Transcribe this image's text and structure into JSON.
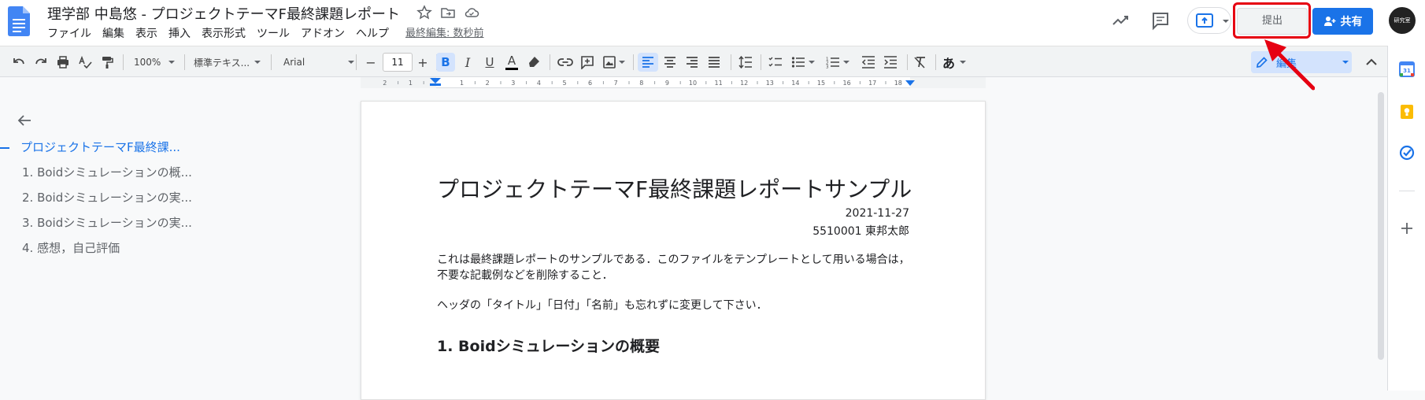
{
  "header": {
    "doc_title": "理学部 中島悠 - プロジェクトテーマF最終課題レポート",
    "menu": [
      "ファイル",
      "編集",
      "表示",
      "挿入",
      "表示形式",
      "ツール",
      "アドオン",
      "ヘルプ"
    ],
    "last_edit": "最終編集: 数秒前",
    "submit_label": "提出",
    "share_label": "共有",
    "avatar_text": "研究室"
  },
  "toolbar": {
    "zoom": "100%",
    "style": "標準テキス...",
    "font": "Arial",
    "font_size": "11",
    "minus": "−",
    "plus": "+",
    "bold": "B",
    "italic": "I",
    "underline": "U",
    "text_color": "A",
    "input_tool": "あ",
    "edit_mode": "編集"
  },
  "ruler": {
    "ticks": [
      "2",
      "1",
      "1",
      "2",
      "3",
      "4",
      "5",
      "6",
      "7",
      "8",
      "9",
      "10",
      "11",
      "12",
      "13",
      "14",
      "15",
      "16",
      "17",
      "18"
    ]
  },
  "outline": {
    "items": [
      "プロジェクトテーマF最終課...",
      "1. Boidシミュレーションの概...",
      "2. Boidシミュレーションの実...",
      "3. Boidシミュレーションの実...",
      "4. 感想，自己評価"
    ]
  },
  "page": {
    "title": "プロジェクトテーマF最終課題レポートサンプル",
    "date": "2021-11-27",
    "author": "5510001 東邦太郎",
    "para1": "これは最終課題レポートのサンプルである．このファイルをテンプレートとして用いる場合は，不要な記載例などを削除すること．",
    "para2": "ヘッダの「タイトル」「日付」「名前」も忘れずに変更して下さい．",
    "heading1": "1. Boidシミュレーションの概要"
  },
  "colors": {
    "accent": "#1a73e8",
    "highlight": "#e60012"
  }
}
